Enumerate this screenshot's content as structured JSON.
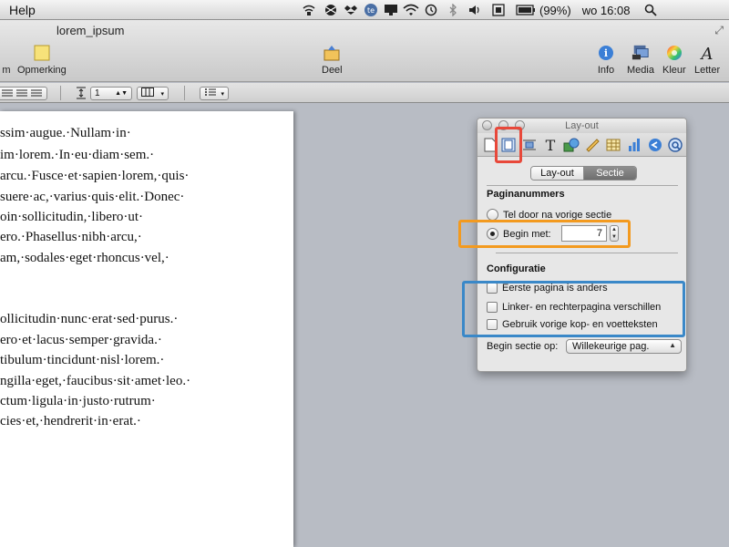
{
  "menubar": {
    "app_menu": "Help",
    "battery": "(99%)",
    "clock": "wo 16:08"
  },
  "toolbar": {
    "doc_title": "lorem_ipsum",
    "left_partial_label": "m",
    "comment_label": "Opmerking",
    "share_label": "Deel",
    "info_label": "Info",
    "media_label": "Media",
    "color_label": "Kleur",
    "font_label": "Letter"
  },
  "formatbar": {
    "line_spacing_value": "1"
  },
  "document": {
    "lines": [
      "ssim·augue.·Nullam·in·",
      "im·lorem.·In·eu·diam·sem.·",
      "arcu.·Fusce·et·sapien·lorem,·quis·",
      "suere·ac,·varius·quis·elit.·Donec·",
      "oin·sollicitudin,·libero·ut·",
      "ero.·Phasellus·nibh·arcu,·",
      "am,·sodales·eget·rhoncus·vel,·",
      "ollicitudin·nunc·erat·sed·purus.·",
      "ero·et·lacus·semper·gravida.·",
      "tibulum·tincidunt·nisl·lorem.·",
      "ngilla·eget,·faucibus·sit·amet·leo.·",
      "ctum·ligula·in·justo·rutrum·",
      "cies·et,·hendrerit·in·erat.·"
    ]
  },
  "inspector": {
    "title": "Lay-out",
    "segments": {
      "layout": "Lay-out",
      "section": "Sectie"
    },
    "page_numbers": {
      "heading": "Paginanummers",
      "continue_label": "Tel door na vorige sectie",
      "start_at_label": "Begin met:",
      "start_at_value": "7"
    },
    "configuration": {
      "heading": "Configuratie",
      "first_page_label": "Eerste pagina is anders",
      "left_right_label": "Linker- en rechterpagina verschillen",
      "use_previous_label": "Gebruik vorige kop- en voetteksten"
    },
    "start_section": {
      "label": "Begin sectie op:",
      "value": "Willekeurige pag."
    }
  },
  "highlights": {
    "red": "#e8483a",
    "orange": "#f39a1f",
    "blue": "#3a88c8"
  }
}
